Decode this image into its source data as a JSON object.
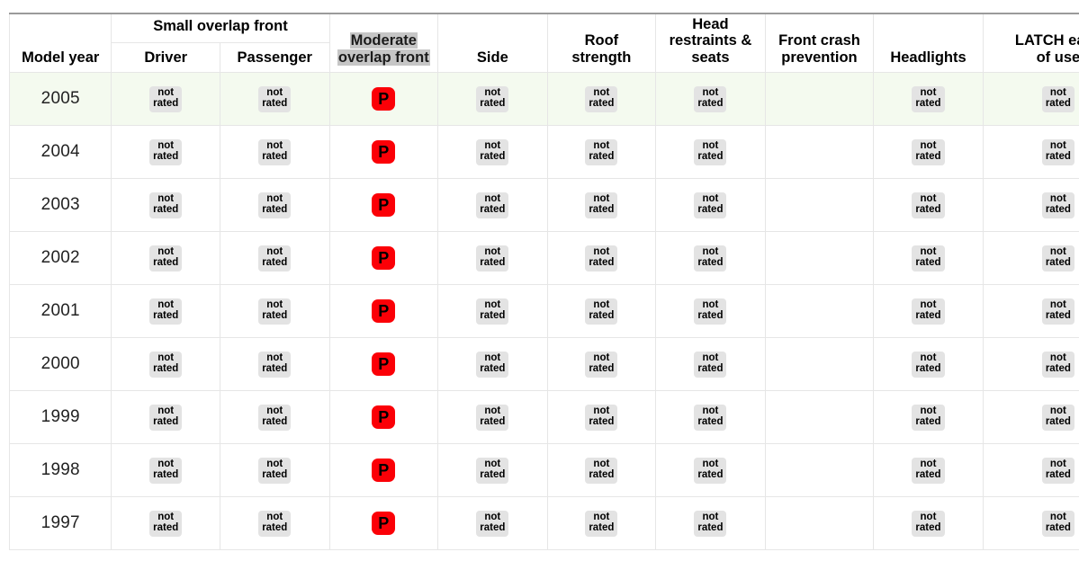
{
  "table": {
    "name": "vehicle-crash-test-ratings",
    "highlighted_column": "Moderate overlap front",
    "colors": {
      "poor_rating_red": "#fb0007",
      "not_rated_badge_bg": "#e3e3e3",
      "highlight_row_bg": "#f4faef",
      "column_highlight_bg": "#c6c6c6",
      "grid_line": "#e6e6e6",
      "header_top_rule": "#9a9a9a"
    },
    "header": {
      "model_year": "Model year",
      "group_small_overlap_front": "Small overlap front",
      "small_overlap_driver": "Driver",
      "small_overlap_passenger": "Passenger",
      "moderate_overlap_front_line1": "Moderate",
      "moderate_overlap_front_line2": "overlap front",
      "side": "Side",
      "roof_strength_line1": "Roof",
      "roof_strength_line2": "strength",
      "head_restraints_line1": "Head",
      "head_restraints_line2": "restraints &",
      "head_restraints_line3": "seats",
      "front_crash_line1": "Front crash",
      "front_crash_line2": "prevention",
      "headlights": "Headlights",
      "latch_line1": "LATCH ease",
      "latch_line2": "of use"
    },
    "badge_labels": {
      "not_rated_line1": "not",
      "not_rated_line2": "rated",
      "poor": "P"
    },
    "columns": [
      "Model year",
      "Small overlap front - Driver",
      "Small overlap front - Passenger",
      "Moderate overlap front",
      "Side",
      "Roof strength",
      "Head restraints & seats",
      "Front crash prevention",
      "Headlights",
      "LATCH ease of use"
    ],
    "rows": [
      {
        "year": "2005",
        "highlighted": true,
        "cells": [
          "not rated",
          "not rated",
          "P",
          "not rated",
          "not rated",
          "not rated",
          "",
          "not rated",
          "not rated"
        ]
      },
      {
        "year": "2004",
        "highlighted": false,
        "cells": [
          "not rated",
          "not rated",
          "P",
          "not rated",
          "not rated",
          "not rated",
          "",
          "not rated",
          "not rated"
        ]
      },
      {
        "year": "2003",
        "highlighted": false,
        "cells": [
          "not rated",
          "not rated",
          "P",
          "not rated",
          "not rated",
          "not rated",
          "",
          "not rated",
          "not rated"
        ]
      },
      {
        "year": "2002",
        "highlighted": false,
        "cells": [
          "not rated",
          "not rated",
          "P",
          "not rated",
          "not rated",
          "not rated",
          "",
          "not rated",
          "not rated"
        ]
      },
      {
        "year": "2001",
        "highlighted": false,
        "cells": [
          "not rated",
          "not rated",
          "P",
          "not rated",
          "not rated",
          "not rated",
          "",
          "not rated",
          "not rated"
        ]
      },
      {
        "year": "2000",
        "highlighted": false,
        "cells": [
          "not rated",
          "not rated",
          "P",
          "not rated",
          "not rated",
          "not rated",
          "",
          "not rated",
          "not rated"
        ]
      },
      {
        "year": "1999",
        "highlighted": false,
        "cells": [
          "not rated",
          "not rated",
          "P",
          "not rated",
          "not rated",
          "not rated",
          "",
          "not rated",
          "not rated"
        ]
      },
      {
        "year": "1998",
        "highlighted": false,
        "cells": [
          "not rated",
          "not rated",
          "P",
          "not rated",
          "not rated",
          "not rated",
          "",
          "not rated",
          "not rated"
        ]
      },
      {
        "year": "1997",
        "highlighted": false,
        "cells": [
          "not rated",
          "not rated",
          "P",
          "not rated",
          "not rated",
          "not rated",
          "",
          "not rated",
          "not rated"
        ]
      }
    ]
  }
}
